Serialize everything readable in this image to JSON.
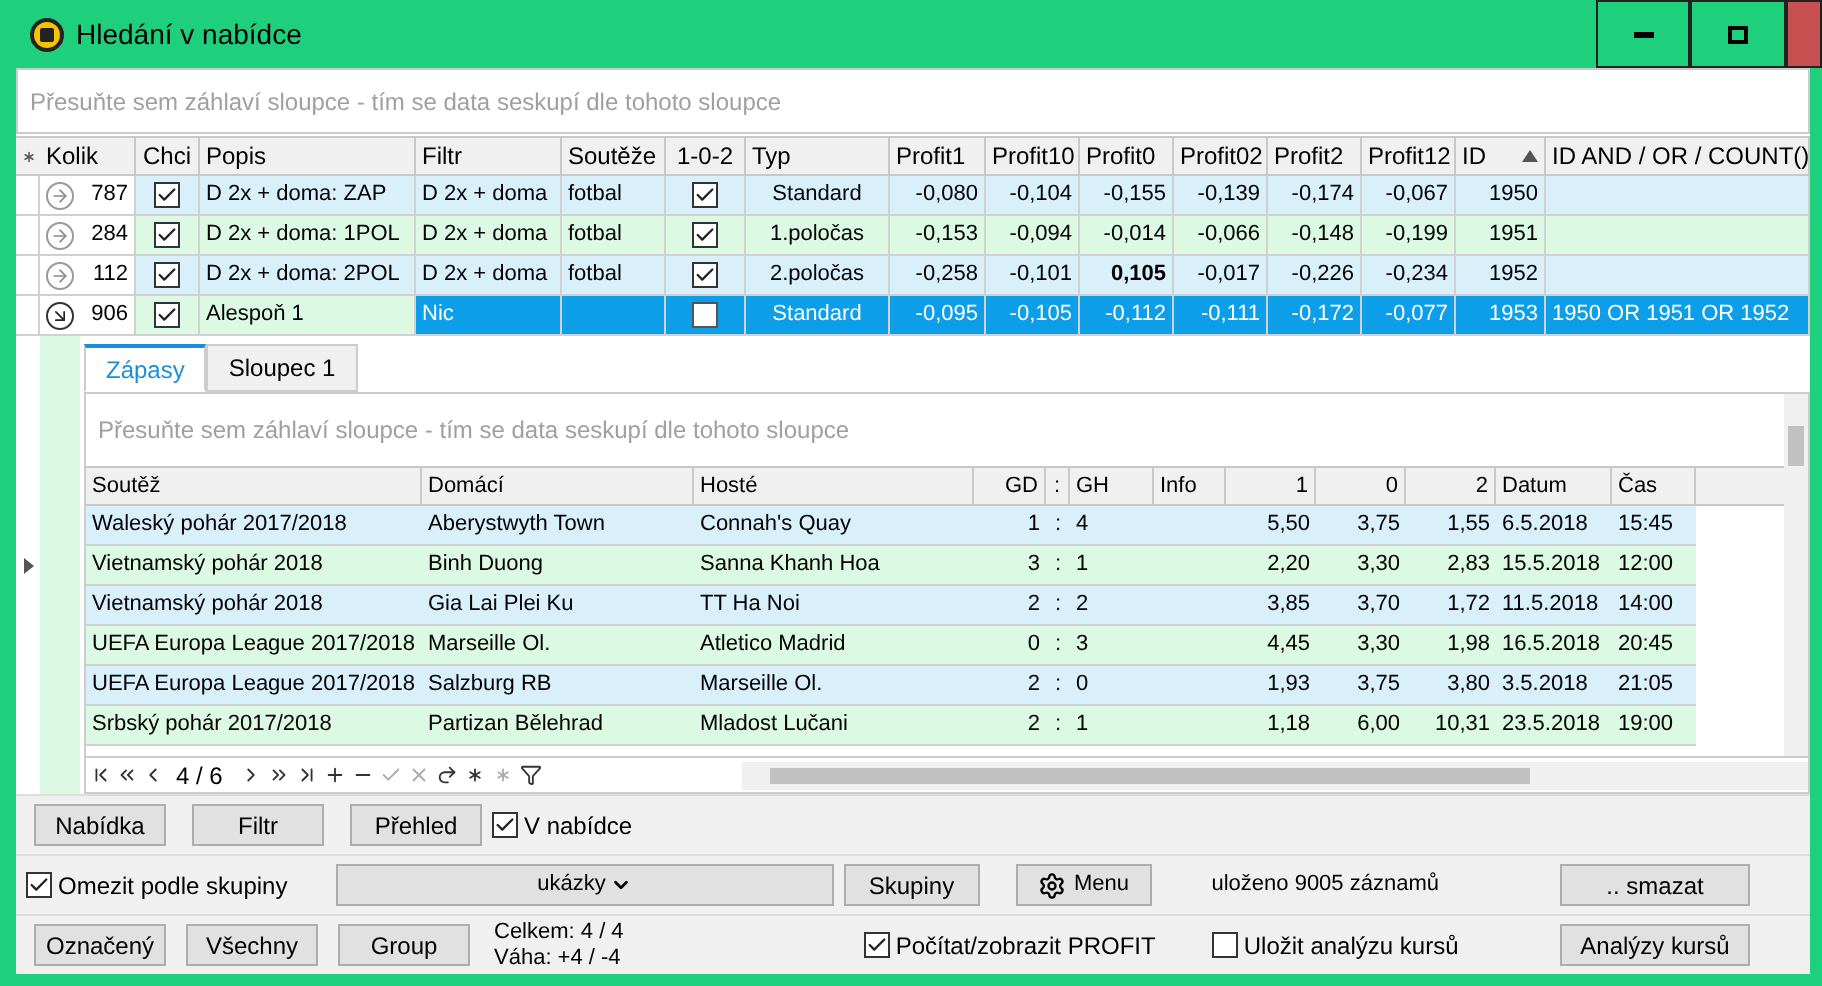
{
  "window": {
    "title": "Hledání v nabídce"
  },
  "group_hint": "Přesuňte sem záhlaví sloupce - tím se data seskupí dle tohoto sloupce",
  "grid": {
    "columns": [
      "Kolik",
      "Chci",
      "Popis",
      "Filtr",
      "Soutěže",
      "1-0-2",
      "Typ",
      "Profit1",
      "Profit10",
      "Profit0",
      "Profit02",
      "Profit2",
      "Profit12",
      "ID",
      "ID AND / OR / COUNT()"
    ],
    "rows": [
      {
        "selected": false,
        "expanded": false,
        "kolik": "787",
        "chci": true,
        "popis": "D 2x + doma: ZAP",
        "filtr": "D 2x + doma",
        "souteze": "fotbal",
        "one_zero_two": true,
        "typ": "Standard",
        "profits": [
          {
            "value": "-0,080",
            "bold": false
          },
          {
            "value": "-0,104",
            "bold": false
          },
          {
            "value": "-0,155",
            "bold": false
          },
          {
            "value": "-0,139",
            "bold": false
          },
          {
            "value": "-0,174",
            "bold": false
          },
          {
            "value": "-0,067",
            "bold": false
          }
        ],
        "id": "1950"
      },
      {
        "selected": false,
        "expanded": false,
        "kolik": "284",
        "chci": true,
        "popis": "D 2x + doma: 1POL",
        "filtr": "D 2x + doma",
        "souteze": "fotbal",
        "one_zero_two": true,
        "typ": "1.poločas",
        "profits": [
          {
            "value": "-0,153",
            "bold": false
          },
          {
            "value": "-0,094",
            "bold": false
          },
          {
            "value": "-0,014",
            "bold": false
          },
          {
            "value": "-0,066",
            "bold": false
          },
          {
            "value": "-0,148",
            "bold": false
          },
          {
            "value": "-0,199",
            "bold": false
          }
        ],
        "id": "1951"
      },
      {
        "selected": false,
        "expanded": false,
        "kolik": "112",
        "chci": true,
        "popis": "D 2x + doma: 2POL",
        "filtr": "D 2x + doma",
        "souteze": "fotbal",
        "one_zero_two": true,
        "typ": "2.poločas",
        "profits": [
          {
            "value": "-0,258",
            "bold": false
          },
          {
            "value": "-0,101",
            "bold": false
          },
          {
            "value": "0,105",
            "bold": true
          },
          {
            "value": "-0,017",
            "bold": false
          },
          {
            "value": "-0,226",
            "bold": false
          },
          {
            "value": "-0,234",
            "bold": false
          }
        ],
        "id": "1952"
      },
      {
        "selected": true,
        "expanded": true,
        "kolik": "906",
        "chci": true,
        "popis": "Alespoň 1",
        "filtr": "Nic",
        "one_zero_two": false,
        "typ": "Standard",
        "profits": [
          {
            "value": "-0,095",
            "bold": false
          },
          {
            "value": "-0,105",
            "bold": false
          },
          {
            "value": "-0,112",
            "bold": false
          },
          {
            "value": "-0,111",
            "bold": false
          },
          {
            "value": "-0,172",
            "bold": false
          },
          {
            "value": "-0,077",
            "bold": false
          }
        ],
        "id": "1953",
        "expression": "1950 OR 1951 OR 1952"
      }
    ]
  },
  "detail": {
    "tabs": [
      {
        "label": "Zápasy",
        "selected": true
      },
      {
        "label": "Sloupec 1",
        "selected": false
      }
    ],
    "group_hint": "Přesuňte sem záhlaví sloupce - tím se data seskupí dle tohoto sloupce",
    "columns": [
      "Soutěž",
      "Domácí",
      "Hosté",
      "GD",
      ":",
      "GH",
      "Info",
      "1",
      "0",
      "2",
      "Datum",
      "Čas"
    ],
    "rows": [
      [
        "Waleský pohár 2017/2018",
        "Aberystwyth Town",
        "Connah's Quay",
        "1",
        ":",
        "4",
        "",
        "5,50",
        "3,75",
        "1,55",
        "6.5.2018",
        "15:45"
      ],
      [
        "Vietnamský pohár 2018",
        "Binh Duong",
        "Sanna Khanh Hoa",
        "3",
        ":",
        "1",
        "",
        "2,20",
        "3,30",
        "2,83",
        "15.5.2018",
        "12:00"
      ],
      [
        "Vietnamský pohár 2018",
        "Gia Lai Plei Ku",
        "TT Ha Noi",
        "2",
        ":",
        "2",
        "",
        "3,85",
        "3,70",
        "1,72",
        "11.5.2018",
        "14:00"
      ],
      [
        "UEFA Europa League 2017/2018",
        "Marseille Ol.",
        "Atletico Madrid",
        "0",
        ":",
        "3",
        "",
        "4,45",
        "3,30",
        "1,98",
        "16.5.2018",
        "20:45"
      ],
      [
        "UEFA Europa League 2017/2018",
        "Salzburg RB",
        "Marseille Ol.",
        "2",
        ":",
        "0",
        "",
        "1,93",
        "3,75",
        "3,80",
        "3.5.2018",
        "21:05"
      ],
      [
        "Srbský pohár 2017/2018",
        "Partizan Bělehrad",
        "Mladost Lučani",
        "2",
        ":",
        "1",
        "",
        "1,18",
        "6,00",
        "10,31",
        "23.5.2018",
        "19:00"
      ]
    ],
    "position": "4 / 6"
  },
  "toolbar1": {
    "buttons": [
      "Nabídka",
      "Filtr",
      "Přehled"
    ],
    "checkbox": {
      "label": "V nabídce",
      "checked": true
    }
  },
  "toolbar2": {
    "checkbox": {
      "label": "Omezit podle skupiny",
      "checked": true
    },
    "dropdown": "ukázky",
    "buttons": [
      "Skupiny",
      "Menu"
    ],
    "status": "uloženo 9005 záznamů",
    "delete": ".. smazat"
  },
  "toolbar3": {
    "buttons": [
      "Označený",
      "Všechny",
      "Group"
    ],
    "total": "Celkem: 4 / 4",
    "weight": "Váha: +4 / -4",
    "checkboxes": [
      {
        "label": "Počítat/zobrazit PROFIT",
        "checked": true
      },
      {
        "label": "Uložit analýzu kursů",
        "checked": false
      }
    ],
    "analysis": "Analýzy kursů"
  }
}
